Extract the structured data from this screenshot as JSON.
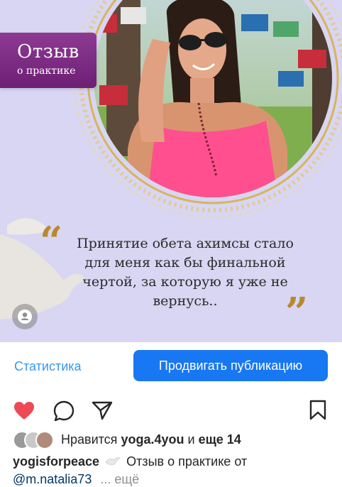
{
  "post": {
    "badge_title": "Отзыв",
    "badge_subtitle": "о практике",
    "quote_open": "“",
    "quote_close": "”",
    "quote_text": "Принятие обета ахимсы стало для меня как бы финальной чертой, за которую я уже не вернусь..",
    "user_tag_icon": "person-icon"
  },
  "actions": {
    "stats_label": "Статистика",
    "promote_label": "Продвигать публикацию",
    "icons": [
      "heart-icon",
      "comment-icon",
      "share-icon",
      "bookmark-icon"
    ]
  },
  "likes": {
    "prefix": "Нравится",
    "user": "yoga.4you",
    "connector": "и",
    "others": "еще 14"
  },
  "caption": {
    "username": "yogisforpeace",
    "text": "Отзыв о практике от",
    "mention": "@m.natalia73",
    "more": "... ещё"
  },
  "colors": {
    "accent": "#1877f2",
    "link": "#3897f0",
    "heart": "#ed4956",
    "badge": "#7a2b80",
    "gold": "#b8892e",
    "background": "#d6d4f0"
  }
}
